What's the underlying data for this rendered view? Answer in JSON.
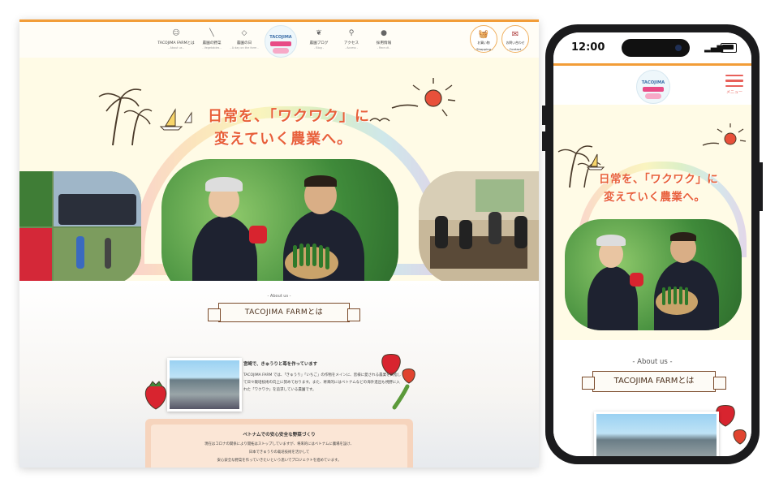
{
  "desktop": {
    "nav": [
      {
        "jp": "TACOJIMA FARMとは",
        "en": "- About us -",
        "icon": "farmer-icon"
      },
      {
        "jp": "農園の野菜",
        "en": "- Vegetables -",
        "icon": "knife-icon"
      },
      {
        "jp": "農園の日",
        "en": "- A day on the farm -",
        "icon": "tag-icon"
      },
      {
        "jp": "農園ブログ",
        "en": "- Blog -",
        "icon": "leaf-icon"
      },
      {
        "jp": "アクセス",
        "en": "- Access -",
        "icon": "pin-icon"
      },
      {
        "jp": "採用情報",
        "en": "- Recruit -",
        "icon": "person-icon"
      }
    ],
    "logo_text": "TACOJIMA",
    "buttons": [
      {
        "label": "お買い物",
        "sub": "- Shopping -",
        "icon": "basket-icon"
      },
      {
        "label": "お問い合わせ",
        "sub": "- Contact -",
        "icon": "mail-icon"
      }
    ],
    "catch_line1": "日常を、「ワクワク」に",
    "catch_line2": "変えていく農業へ。",
    "about": {
      "small": "- About us -",
      "title": "TACOJIMA FARMとは",
      "heading": "宮崎で、きゅうりと苺を作っています",
      "body": "TACOJIMA FARM では、「きゅうり」「いちご」の作物をメインに、皆様に愛される農業を目指して日々栽培技術の向上に努めております。また、将来的にはベトナムなどの海外進出も視野に入れた「ワクワク」を追求している農園です。",
      "card_title": "ベトナムでの安心安全な野菜づくり",
      "card_lines": [
        "現在はコロナの関係により開拓はストップしていますが、将来的にはベトナムに農場を設け、",
        "日本できゅうりの栽培技術を活かして",
        "安心安全な野菜を作っていきたいという思いでプロジェクトを進めています。"
      ]
    }
  },
  "mobile": {
    "time": "12:00",
    "logo_text": "TACOJIMA",
    "menu_label": "メニュー",
    "catch_line1": "日常を、「ワクワク」に",
    "catch_line2": "変えていく農業へ。",
    "slider_active": 2,
    "slider_count": 3,
    "about_small": "- About us -",
    "about_title": "TACOJIMA FARMとは"
  },
  "colors": {
    "accent": "#f29d38",
    "catch": "#e8603a",
    "menu": "#e8605a"
  }
}
